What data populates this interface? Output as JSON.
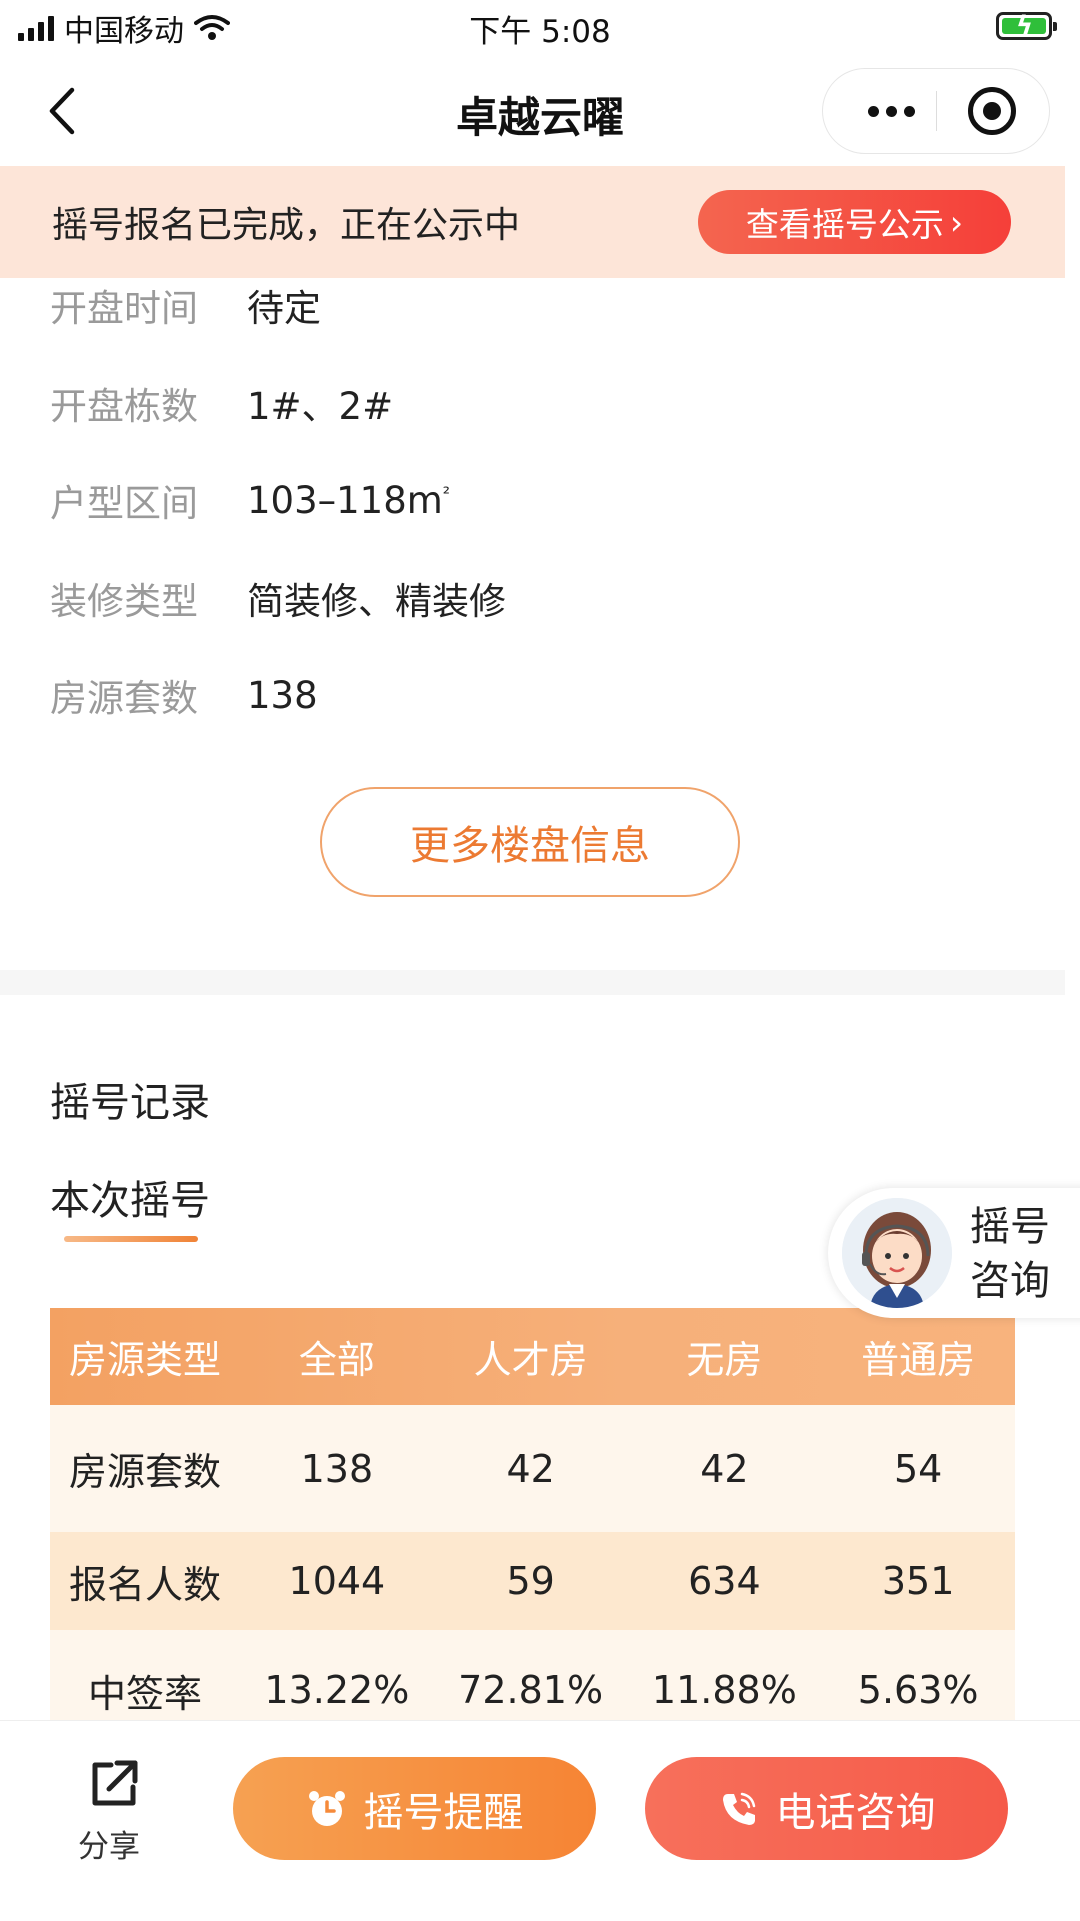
{
  "status_bar": {
    "carrier": "中国移动",
    "time": "下午 5:08"
  },
  "nav": {
    "title": "卓越云曜"
  },
  "notice": {
    "text": "摇号报名已完成，正在公示中",
    "button_label": "查看摇号公示",
    "button_arrow": "›"
  },
  "info": [
    {
      "label": "开盘时间",
      "value": "待定"
    },
    {
      "label": "开盘栋数",
      "value": "1#、2#"
    },
    {
      "label": "户型区间",
      "value": "103–118m",
      "unit_sup": "²"
    },
    {
      "label": "装修类型",
      "value": "简装修、精装修"
    },
    {
      "label": "房源套数",
      "value": "138"
    }
  ],
  "more_button_label": "更多楼盘信息",
  "record": {
    "title": "摇号记录",
    "tab_label": "本次摇号"
  },
  "consult_float": {
    "line1": "摇号",
    "line2": "咨询"
  },
  "table": {
    "headers": [
      "房源类型",
      "全部",
      "人才房",
      "无房",
      "普通房"
    ],
    "rows": [
      [
        "房源套数",
        "138",
        "42",
        "42",
        "54"
      ],
      [
        "报名人数",
        "1044",
        "59",
        "634",
        "351"
      ],
      [
        "中签率",
        "13.22%",
        "72.81%",
        "11.88%",
        "5.63%"
      ]
    ]
  },
  "bottom_bar": {
    "share_label": "分享",
    "remind_label": "摇号提醒",
    "phone_label": "电话咨询"
  },
  "colors": {
    "accent_orange": "#f08337",
    "notice_bg": "#fde5d8",
    "notice_button": "#f53f39",
    "phone_button": "#f55a49"
  },
  "icons": {
    "back": "chevron-left-icon",
    "more": "more-dots-icon",
    "close": "target-close-icon",
    "share": "share-icon",
    "alarm": "alarm-clock-icon",
    "phone": "phone-icon"
  }
}
